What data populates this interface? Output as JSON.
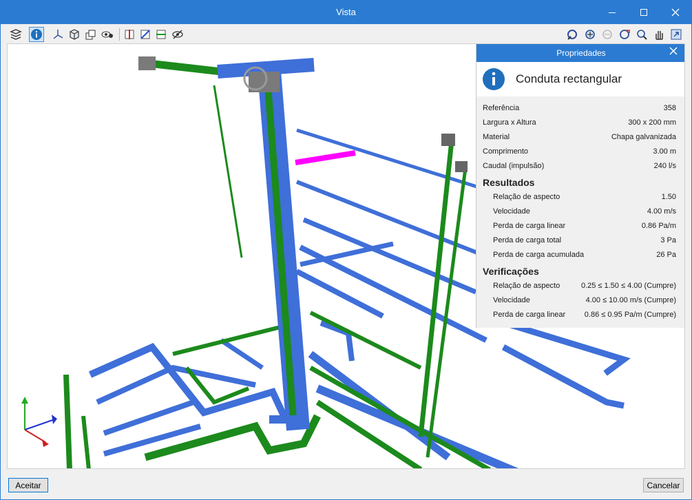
{
  "window": {
    "title": "Vista"
  },
  "toolbar": {
    "left_icons": [
      "layers-icon",
      "info-icon",
      "axes-icon",
      "cube-view-icon",
      "views-stack-icon",
      "visibility-icon",
      "section-red-icon",
      "section-blue-icon",
      "section-green-icon",
      "eye-off-icon"
    ],
    "right_icons": [
      "rotate-icon",
      "zoom-extents-icon",
      "zoom-previous-icon",
      "zoom-dynamic-icon",
      "zoom-window-icon",
      "pan-hand-icon",
      "export-icon"
    ]
  },
  "properties": {
    "header": "Propriedades",
    "element_title": "Conduta rectangular",
    "general": [
      {
        "label": "Referência",
        "value": "358"
      },
      {
        "label": "Largura x Altura",
        "value": "300 x 200 mm"
      },
      {
        "label": "Material",
        "value": "Chapa galvanizada"
      },
      {
        "label": "Comprimento",
        "value": "3.00 m"
      },
      {
        "label": "Caudal (impulsão)",
        "value": "240 l/s"
      }
    ],
    "results_title": "Resultados",
    "results": [
      {
        "label": "Relação de aspecto",
        "value": "1.50"
      },
      {
        "label": "Velocidade",
        "value": "4.00 m/s"
      },
      {
        "label": "Perda de carga linear",
        "value": "0.86 Pa/m"
      },
      {
        "label": "Perda de carga total",
        "value": "3 Pa"
      },
      {
        "label": "Perda de carga acumulada",
        "value": "26 Pa"
      }
    ],
    "checks_title": "Verificações",
    "checks": [
      {
        "label": "Relação de aspecto",
        "value": "0.25 ≤ 1.50 ≤ 4.00 (Cumpre)"
      },
      {
        "label": "Velocidade",
        "value": "4.00 ≤ 10.00 m/s (Cumpre)"
      },
      {
        "label": "Perda de carga linear",
        "value": "0.86 ≤ 0.95 Pa/m (Cumpre)"
      }
    ]
  },
  "footer": {
    "accept": "Aceitar",
    "cancel": "Cancelar"
  },
  "colors": {
    "accent": "#2b7bd2",
    "duct_blue": "#3f6fd8",
    "duct_green": "#1c8a1c",
    "selected": "#ff00ff"
  }
}
